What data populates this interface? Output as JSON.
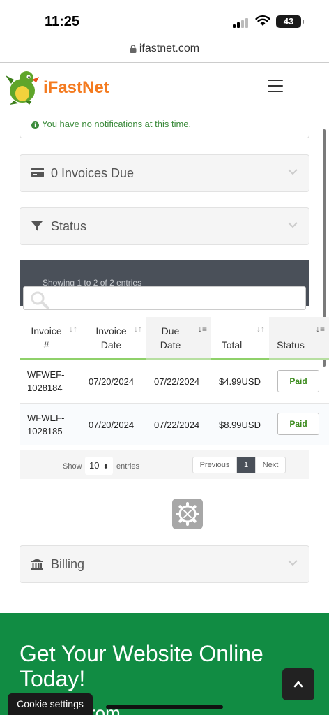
{
  "status_bar": {
    "time": "11:25",
    "battery": "43"
  },
  "browser": {
    "url": "ifastnet.com"
  },
  "header": {
    "brand": "iFastNet"
  },
  "notification": {
    "text": "You have no notifications at this time."
  },
  "panels": {
    "invoices_due": "0 Invoices Due",
    "status": "Status",
    "billing": "Billing"
  },
  "table": {
    "info": "Showing 1 to 2 of 2 entries",
    "columns": [
      {
        "line1": "Invoice",
        "line2": "#"
      },
      {
        "line1": "Invoice",
        "line2": "Date"
      },
      {
        "line1": "Due",
        "line2": "Date"
      },
      {
        "line1": "",
        "line2": "Total"
      },
      {
        "line1": "",
        "line2": "Status"
      }
    ],
    "rows": [
      {
        "invoice_line1": "WFWEF-",
        "invoice_line2": "1028184",
        "invoice_date": "07/20/2024",
        "due_date": "07/22/2024",
        "total": "$4.99USD",
        "status": "Paid"
      },
      {
        "invoice_line1": "WFWEF-",
        "invoice_line2": "1028185",
        "invoice_date": "07/20/2024",
        "due_date": "07/22/2024",
        "total": "$8.99USD",
        "status": "Paid"
      }
    ],
    "show_label": "Show",
    "page_length": "10",
    "entries_label": "entries",
    "pagination": {
      "previous": "Previous",
      "current": "1",
      "next": "Next"
    }
  },
  "footer": {
    "title": "Get Your Website Online Today!",
    "subtitle_partial": "rom"
  },
  "cookie": {
    "label": "Cookie settings"
  },
  "colors": {
    "brand_orange": "#f47b20",
    "footer_green": "#118c43",
    "table_bar": "#4a5059",
    "header_accent": "#8fd16a",
    "paid_green": "#3c8b1e"
  }
}
